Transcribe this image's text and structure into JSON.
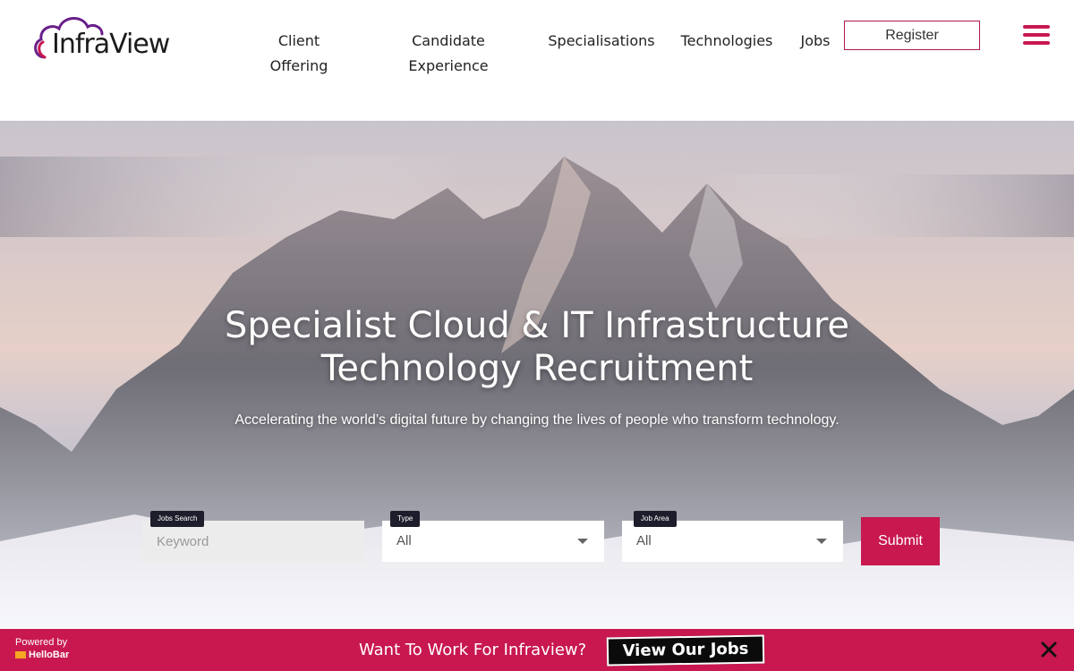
{
  "header": {
    "logo_text": "InfraView",
    "nav": [
      {
        "line1": "Client",
        "line2": "Offering"
      },
      {
        "line1": "Candidate",
        "line2": "Experience"
      },
      {
        "line1": "Specialisations"
      },
      {
        "line1": "Technologies"
      },
      {
        "line1": "Jobs"
      }
    ],
    "register_label": "Register",
    "menu_icon": "hamburger-menu-icon",
    "accent_color": "#c8184f"
  },
  "hero": {
    "headline_line1": "Specialist Cloud & IT Infrastructure",
    "headline_line2": "Technology Recruitment",
    "subline": "Accelerating the world’s digital future by changing the lives of people who transform technology.",
    "search": {
      "keyword_tag": "Jobs Search",
      "keyword_placeholder": "Keyword",
      "type_tag": "Type",
      "type_value": "All",
      "area_tag": "Job Area",
      "area_value": "All",
      "submit_label": "Submit"
    }
  },
  "hellobar": {
    "powered_by": "Powered by",
    "brand": "HelloBar",
    "message": "Want To Work For Infraview?",
    "cta_label": "View Our Jobs",
    "close_icon": "close-icon",
    "color": "#c8184f"
  }
}
